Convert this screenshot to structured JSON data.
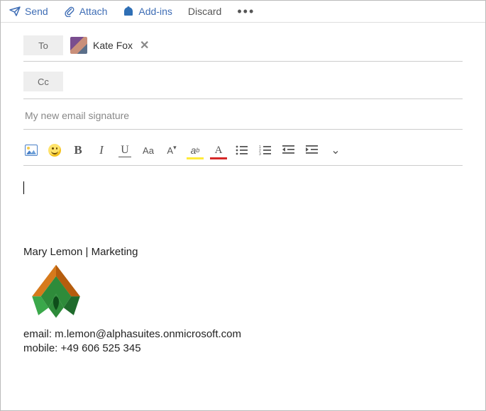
{
  "toolbar": {
    "send": "Send",
    "attach": "Attach",
    "addins": "Add-ins",
    "discard": "Discard"
  },
  "fields": {
    "to_label": "To",
    "cc_label": "Cc"
  },
  "recipient": {
    "name": "Kate Fox"
  },
  "subject_value": "My new email signature",
  "signature": {
    "name_line": "Mary Lemon | Marketing",
    "email_line": "email: m.lemon@alphasuites.onmicrosoft.com",
    "mobile_line": "mobile: +49 606 525 345"
  }
}
